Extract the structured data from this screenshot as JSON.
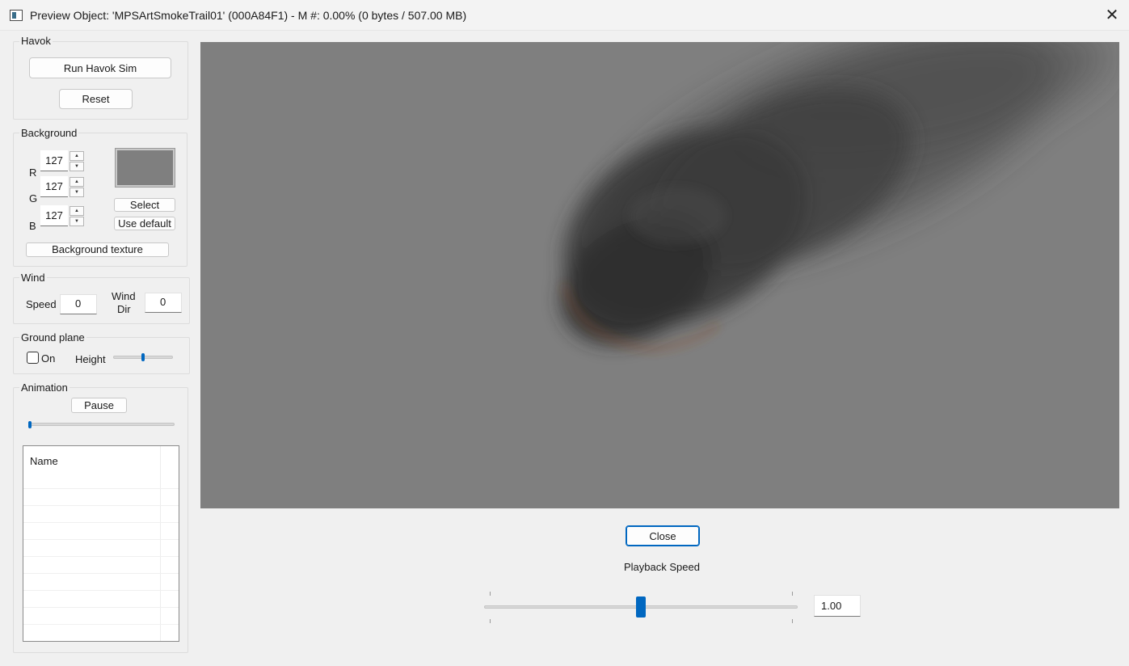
{
  "window": {
    "title": "Preview Object: 'MPSArtSmokeTrail01' (000A84F1) - M #: 0.00% (0 bytes / 507.00 MB)",
    "close_glyph": "✕"
  },
  "havok": {
    "title": "Havok",
    "run_label": "Run Havok Sim",
    "reset_label": "Reset"
  },
  "background": {
    "title": "Background",
    "r_label": "R",
    "r_value": "127",
    "g_label": "G",
    "g_value": "127",
    "b_label": "B",
    "b_value": "127",
    "select_label": "Select",
    "default_label": "Use default",
    "texture_label": "Background texture",
    "swatch_color": "#7f7f7f"
  },
  "wind": {
    "title": "Wind",
    "speed_label": "Speed",
    "speed_value": "0",
    "dir_label_1": "Wind",
    "dir_label_2": "Dir",
    "dir_value": "0"
  },
  "ground_plane": {
    "title": "Ground plane",
    "on_label": "On",
    "on_checked": false,
    "height_label": "Height",
    "height_level": 0.5
  },
  "animation": {
    "title": "Animation",
    "pause_label": "Pause",
    "progress": 0.0,
    "list_header": "Name"
  },
  "viewport": {
    "background_color": "#7f7f7f",
    "content": "smoke trail particle effect"
  },
  "footer": {
    "close_label": "Close",
    "playback_label": "Playback Speed",
    "playback_value": "1.00",
    "playback_level": 0.5
  },
  "colors": {
    "accent": "#0067c0",
    "window_bg": "#f0f0f0"
  }
}
